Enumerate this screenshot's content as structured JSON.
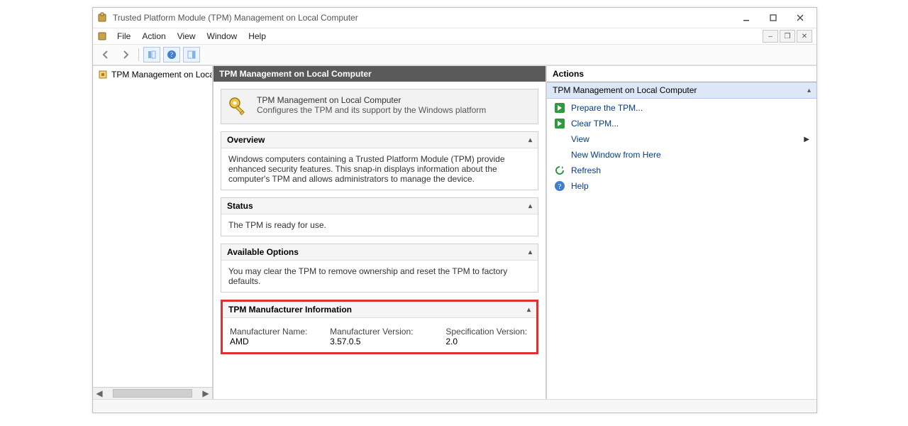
{
  "window": {
    "title": "Trusted Platform Module (TPM) Management on Local Computer"
  },
  "menubar": [
    "File",
    "Action",
    "View",
    "Window",
    "Help"
  ],
  "nav": {
    "root_label": "TPM Management on Local Comp"
  },
  "main": {
    "header": "TPM Management on Local Computer",
    "intro_title": "TPM Management on Local Computer",
    "intro_desc": "Configures the TPM and its support by the Windows platform",
    "overview": {
      "title": "Overview",
      "body": "Windows computers containing a Trusted Platform Module (TPM) provide enhanced security features. This snap-in displays information about the computer's TPM and allows administrators to manage the device."
    },
    "status": {
      "title": "Status",
      "body": "The TPM is ready for use."
    },
    "options": {
      "title": "Available Options",
      "body": "You may clear the TPM to remove ownership and reset the TPM to factory defaults."
    },
    "manufacturer": {
      "title": "TPM Manufacturer Information",
      "name_label": "Manufacturer Name:",
      "name_value": "AMD",
      "version_label": "Manufacturer Version:",
      "version_value": "3.57.0.5",
      "spec_label": "Specification Version:",
      "spec_value": "2.0"
    }
  },
  "actions": {
    "header": "Actions",
    "group_title": "TPM Management on Local Computer",
    "items": [
      {
        "label": "Prepare the TPM..."
      },
      {
        "label": "Clear TPM..."
      },
      {
        "label": "View",
        "has_submenu": true
      },
      {
        "label": "New Window from Here"
      },
      {
        "label": "Refresh"
      },
      {
        "label": "Help"
      }
    ]
  }
}
